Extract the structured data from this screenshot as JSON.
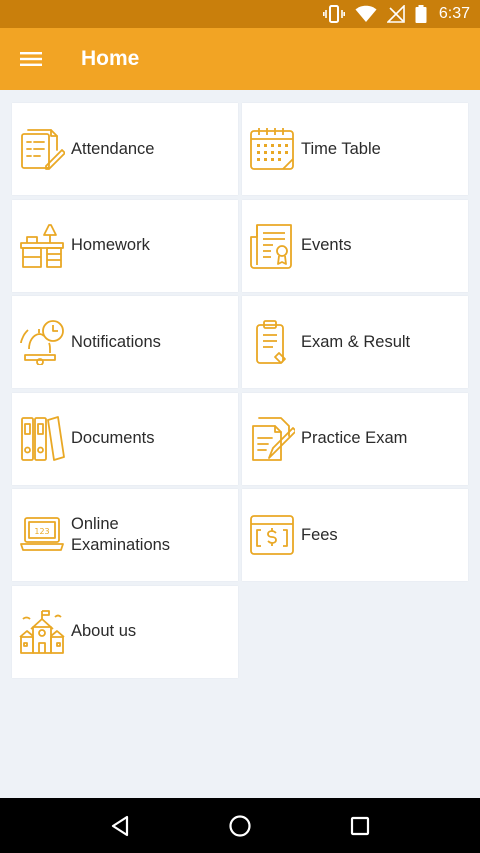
{
  "status_bar": {
    "time": "6:37",
    "icons": [
      "vibrate-icon",
      "wifi-icon",
      "no-signal-icon",
      "battery-icon"
    ]
  },
  "app_bar": {
    "title": "Home",
    "menu_icon": "hamburger-menu-icon"
  },
  "colors": {
    "status_bar": "#c97f0c",
    "app_bar": "#f2a424",
    "icon_accent": "#e9a825",
    "background": "#eef2f7"
  },
  "tiles": [
    {
      "label": "Attendance",
      "icon": "attendance-icon"
    },
    {
      "label": "Time Table",
      "icon": "calendar-icon"
    },
    {
      "label": "Homework",
      "icon": "desk-lamp-icon"
    },
    {
      "label": "Events",
      "icon": "certificate-icon"
    },
    {
      "label": "Notifications",
      "icon": "bell-clock-icon"
    },
    {
      "label": "Exam & Result",
      "icon": "clipboard-icon"
    },
    {
      "label": "Documents",
      "icon": "binders-icon"
    },
    {
      "label": "Practice Exam",
      "icon": "paper-pen-icon"
    },
    {
      "label": "Online\nExaminations",
      "icon": "laptop-icon"
    },
    {
      "label": "Fees",
      "icon": "money-icon"
    },
    {
      "label": "About us",
      "icon": "school-icon"
    }
  ],
  "nav_bar": {
    "icons": [
      "back-icon",
      "home-icon",
      "recents-icon"
    ]
  }
}
